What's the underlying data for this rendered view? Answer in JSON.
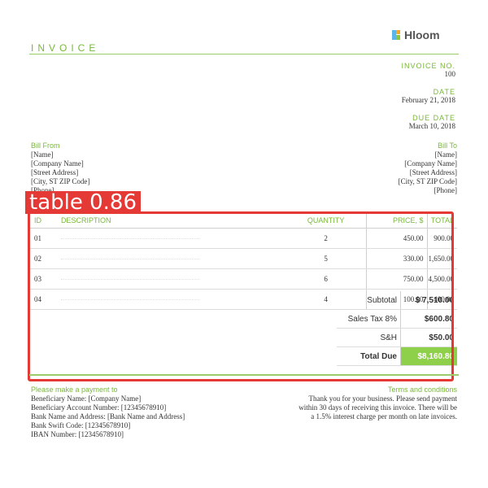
{
  "header": {
    "title": "INVOICE",
    "logo_text": "Hloom"
  },
  "meta": {
    "invoice_no_label": "INVOICE NO.",
    "invoice_no": "100",
    "date_label": "DATE",
    "date": "February 21, 2018",
    "due_label": "DUE DATE",
    "due": "March 10, 2018"
  },
  "bill_from": {
    "label": "Bill From",
    "lines": [
      "[Name]",
      "[Company Name]",
      "[Street Address]",
      "[City, ST ZIP Code]",
      "[Phone]"
    ]
  },
  "bill_to": {
    "label": "Bill To",
    "lines": [
      "[Name]",
      "[Company Name]",
      "[Street Address]",
      "[City, ST ZIP Code]",
      "[Phone]"
    ]
  },
  "detection": {
    "label": "table 0.86",
    "color": "#e53935"
  },
  "table": {
    "headers": {
      "id": "ID",
      "description": "DESCRIPTION",
      "quantity": "QUANTITY",
      "price": "PRICE, $",
      "total": "TOTAL"
    },
    "rows": [
      {
        "id": "01",
        "quantity": "2",
        "price": "450.00",
        "total": "900.00"
      },
      {
        "id": "02",
        "quantity": "5",
        "price": "330.00",
        "total": "1,650.00"
      },
      {
        "id": "03",
        "quantity": "6",
        "price": "750.00",
        "total": "4,500.00"
      },
      {
        "id": "04",
        "quantity": "4",
        "price": "100.00",
        "total": "400.00"
      }
    ]
  },
  "summary": {
    "subtotal_label": "Subtotal",
    "subtotal": "$ 7,510.00",
    "tax_label": "Sales Tax 8%",
    "tax": "$600.80",
    "sh_label": "S&H",
    "sh": "$50.00",
    "total_label": "Total Due",
    "total": "$8,160.80"
  },
  "footer": {
    "payment_label": "Please make a payment to",
    "payment_lines": [
      "Beneficiary Name: [Company Name]",
      "Beneficiary Account Number: [12345678910]",
      "Bank Name and Address: [Bank Name and Address]",
      "Bank Swift Code: [12345678910]",
      "IBAN Number: [12345678910]"
    ],
    "terms_label": "Terms and conditions",
    "terms_text": "Thank you for your business. Please send payment within 30 days of receiving this invoice. There will be a 1.5% interest charge per month on late invoices."
  },
  "colors": {
    "accent": "#78b83a",
    "total_highlight": "#8fd04a",
    "detection": "#e53935"
  }
}
